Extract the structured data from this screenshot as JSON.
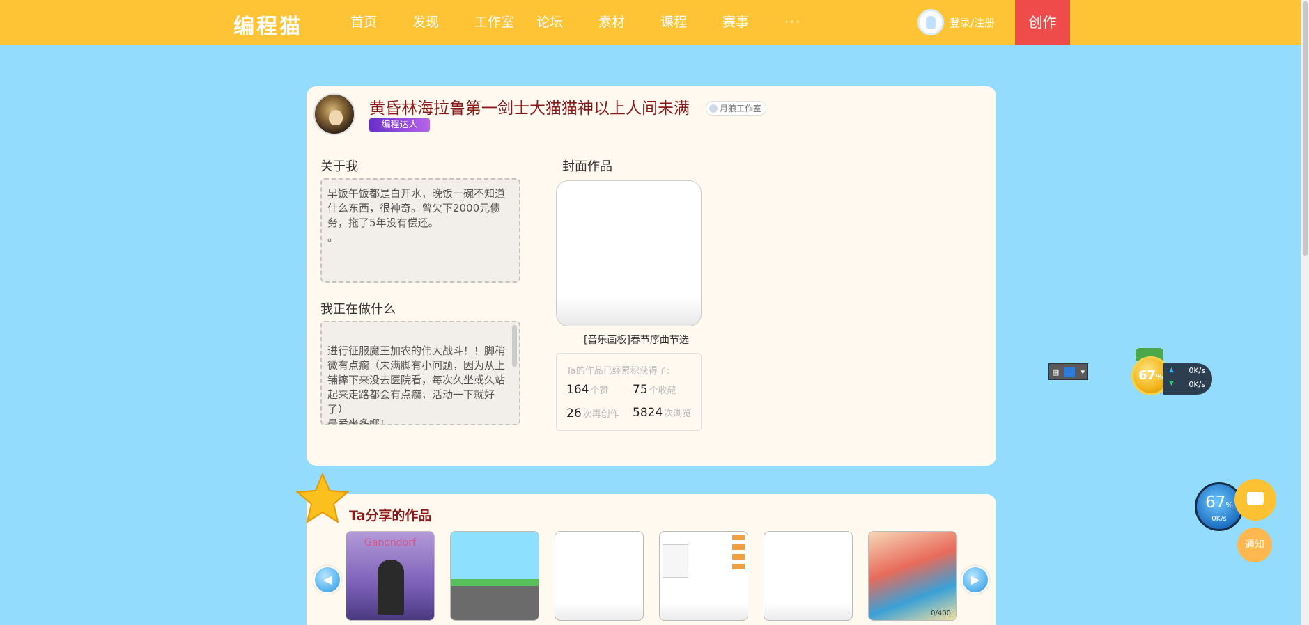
{
  "nav": {
    "logo": "编程猫",
    "items": [
      {
        "label": "首页"
      },
      {
        "label": "发现"
      },
      {
        "label": "工作室"
      },
      {
        "label": "论坛"
      },
      {
        "label": "素材"
      },
      {
        "label": "课程"
      },
      {
        "label": "赛事"
      },
      {
        "label": "···"
      }
    ],
    "login": "登录/注册",
    "create": "创作"
  },
  "profile": {
    "username": "黄昏林海拉鲁第一剑士大猫猫神以上人间未满",
    "studio": "月狼工作室",
    "badge": "编程达人",
    "about_title": "关于我",
    "about_text": "早饭午饭都是白开水，晚饭一碗不知道什么东西，很神奇。曾欠下2000元债务，拖了5年没有偿还。\n。",
    "doing_title": "我正在做什么",
    "doing_text": "进行征服魔王加农的伟大战斗！！脚稍微有点瘸（未满脚有小问题，因为从上铺摔下来没去医院看，每次久坐或久站起来走路都会有点瘸，活动一下就好了）\n最爱米多娜！",
    "cover_title": "封面作品",
    "cover_caption": "[音乐画板]春节序曲节选",
    "stats_head": "Ta的作品已经累积获得了:",
    "stats": [
      {
        "value": "164",
        "unit": "个赞"
      },
      {
        "value": "75",
        "unit": "个收藏"
      },
      {
        "value": "26",
        "unit": "次再创作"
      },
      {
        "value": "5824",
        "unit": "次浏览"
      }
    ]
  },
  "works": {
    "title": "Ta分享的作品",
    "thumb_1_title": "Ganondorf",
    "thumb_6_counter": "0/400"
  },
  "widgets": {
    "medal_value": "67",
    "medal_unit": "%",
    "net_up": "0K/s",
    "net_down": "0K/s",
    "gauge_value": "67",
    "gauge_unit": "%",
    "gauge_speed": "0K/s",
    "notify": "通知"
  },
  "colors": {
    "nav_bg": "#ffc436",
    "create_btn": "#ef4b4b",
    "page_bg": "#93dcfe",
    "card_bg": "#fff9f0",
    "name_color": "#8b1a1a"
  }
}
